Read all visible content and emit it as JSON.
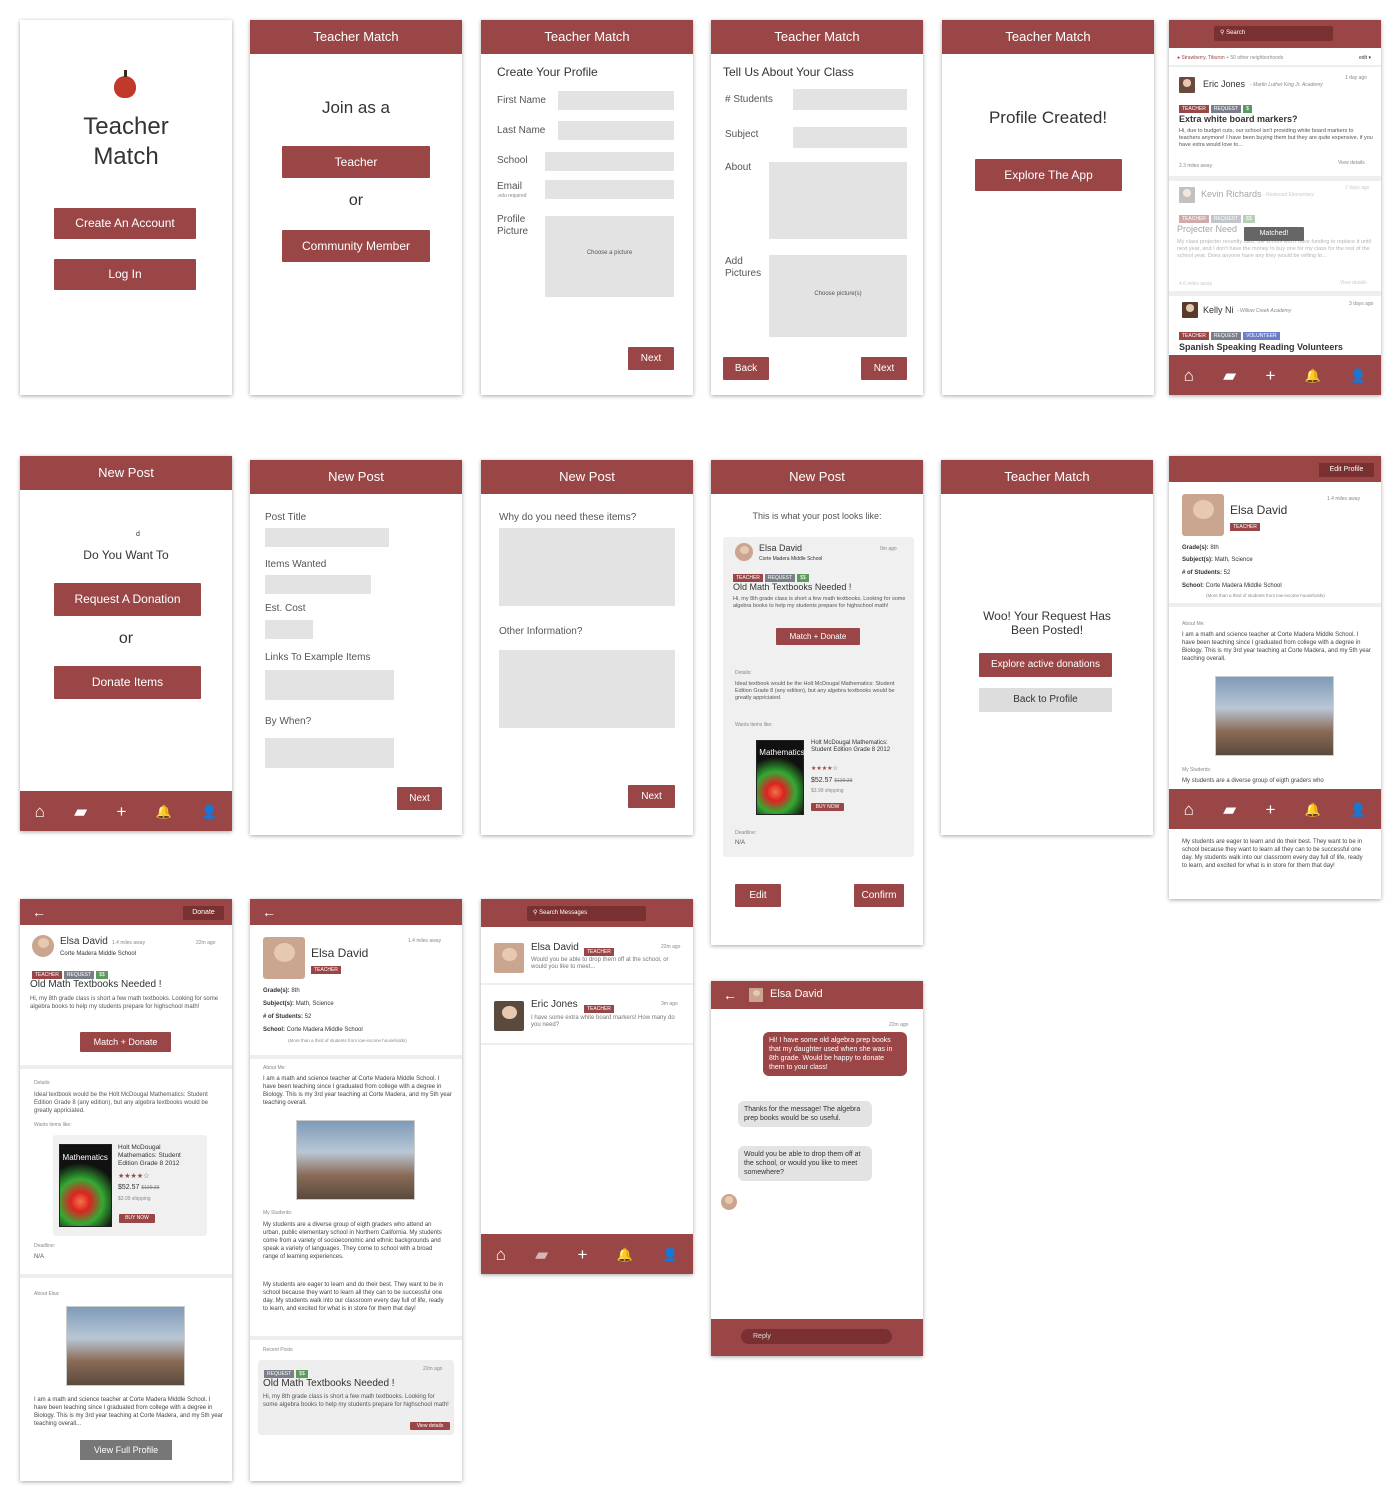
{
  "s1": {
    "title_line1": "Teacher",
    "title_line2": "Match",
    "create": "Create An Account",
    "login": "Log In"
  },
  "s2": {
    "header": "Teacher Match",
    "join": "Join as a",
    "teacher": "Teacher",
    "or": "or",
    "community": "Community Member"
  },
  "s3": {
    "header": "Teacher Match",
    "heading": "Create Your Profile",
    "first": "First Name",
    "last": "Last Name",
    "school": "School",
    "email": "Email",
    "edu": ".edu required",
    "pic1": "Profile",
    "pic2": "Picture",
    "choose": "Choose a picture",
    "next": "Next"
  },
  "s4": {
    "header": "Teacher Match",
    "heading": "Tell Us About Your Class",
    "students": "# Students",
    "subject": "Subject",
    "about": "About",
    "add1": "Add",
    "add2": "Pictures",
    "choose": "Choose picture(s)",
    "back": "Back",
    "next": "Next"
  },
  "s5": {
    "header": "Teacher Match",
    "created": "Profile Created!",
    "explore": "Explore The App"
  },
  "s6": {
    "search": "Search",
    "location": "Strawberry, Tiburon",
    "neighborhoods": "+ 50 other neighborhoods",
    "edit": "edit ▾",
    "post1": {
      "name": "Eric Jones",
      "school": "- Martin Luther King Jr. Academy",
      "time": "1 day ago",
      "title": "Extra white board markers?",
      "body": "Hi, due to budget cuts, our school isn't providing white board markers to teachers anymore! I have been buying them but they are quite expensive, if you have extra would love to...",
      "distance": "2.3 miles away",
      "details": "View details"
    },
    "post2": {
      "name": "Kevin Richards",
      "school": "- Redwood Elementary",
      "time": "2 days ago",
      "title": "Projecter Need",
      "matched": "Matched!",
      "body": "My class projecter recently died, the school won't have funding to replace it until next year, and I don't have the money to buy one for my class for the rest of the school year. Does anyone have any they would be willing to...",
      "distance": "4.6 miles away",
      "details": "View details"
    },
    "post3": {
      "name": "Kelly Ni",
      "school": "- Willow Creek Academy",
      "time": "3 days ago",
      "title": "Spanish Speaking Reading Volunteers"
    }
  },
  "tags": {
    "teacher": "TEACHER",
    "request": "REQUEST",
    "money": "$$",
    "vol": "VOLUNTEER",
    "money1": "$"
  },
  "s7": {
    "header": "New Post",
    "d": "d",
    "want": "Do You Want To",
    "request": "Request A Donation",
    "or": "or",
    "donate": "Donate Items"
  },
  "s8": {
    "header": "New Post",
    "title": "Post Title",
    "items": "Items Wanted",
    "cost": "Est. Cost",
    "links": "Links To Example Items",
    "when": "By When?",
    "next": "Next"
  },
  "s9": {
    "header": "New Post",
    "why": "Why do you need these items?",
    "other": "Other Information?",
    "next": "Next"
  },
  "s10": {
    "header": "New Post",
    "preview": "This is what your post looks like:",
    "name": "Elsa David",
    "school": "Corte Madera Middle School",
    "time": "0m ago",
    "title": "Old Math Textbooks Needed !",
    "body": "Hi, my 8th grade class is short a few math textbooks. Looking for some algebra books to help my students prepare for highschool math!",
    "match": "Match + Donate",
    "details_label": "Details:",
    "details": "Ideal textbook would be the Holt McDougal Mathematics: Student Edition Grade 8 (any edition), but any algebra textbooks would be greatly appriciated.",
    "wants": "Wants items like:",
    "book_title": "Holt McDougal Mathematics: Student Edition Grade 8 2012",
    "stars": "★★★★☆",
    "price": "$52.57",
    "old_price": "$139.33",
    "shipping": "$3.99 shipping",
    "buy": "BUY NOW",
    "deadline_label": "Deadline:",
    "deadline": "N/A",
    "edit": "Edit",
    "confirm": "Confirm",
    "book_cover": "Mathematics"
  },
  "s11": {
    "header": "Teacher Match",
    "posted1": "Woo! Your Request Has",
    "posted2": "Been Posted!",
    "explore": "Explore active donations",
    "back": "Back to Profile"
  },
  "s12": {
    "edit": "Edit Profile",
    "distance": "1.4 miles away",
    "name": "Elsa David",
    "grades_l": "Grade(s):",
    "grades": "8th",
    "subjects_l": "Subject(s):",
    "subjects": "Math, Science",
    "students_l": "# of Students:",
    "students": "52",
    "school_l": "School:",
    "school": "Corte Madera Middle School",
    "note": "(More than a third of students from low-income households)",
    "about_l": "About Me:",
    "about": "I am a math and science teacher at Corte Madera Middle School. I have been teaching since I graduated from college with a degree in Biology. This is my 3rd year teaching at Corte Madera, and my 5th year teaching overall.",
    "mystudents_l": "My Students:",
    "mystudents": "My students are a diverse group of eigth graders who",
    "below": "My students are eager to learn and do their best. They want to be in school because they want to learn all they can to be successful one day. My students walk into our classroom every day full of life, ready to learn, and excited for what is in store for them that day!"
  },
  "s13": {
    "donate": "Donate",
    "name": "Elsa David",
    "distance": "1.4 miles away",
    "time": "22m ago",
    "school": "Corte Madera Middle School",
    "title": "Old Math Textbooks Needed !",
    "body": "Hi, my 8th grade class is short a few math textbooks. Looking for some algebra books to help my students prepare for highschool math!",
    "match": "Match + Donate",
    "details_label": "Details:",
    "details": "Ideal textbook would be the Holt McDougal Mathematics: Student Edition Grade 8 (any edition), but any algebra textbooks would be greatly appriciated.",
    "wants": "Wants items like:",
    "deadline_label": "Deadline:",
    "deadline": "N/A",
    "about_l": "About Elsa:",
    "about": "I am a math and science teacher at Corte Madera Middle School. I have been teaching since I graduated from college with a degree in Biology. This is my 3rd year teaching at Corte Madera, and my 5th year teaching overall...",
    "full": "View Full Profile"
  },
  "s14": {
    "name": "Elsa David",
    "distance": "1.4 miles away",
    "grades_l": "Grade(s):",
    "grades": "8th",
    "subjects_l": "Subject(s):",
    "subjects": "Math, Science",
    "students_l": "# of Students:",
    "students": "52",
    "school_l": "School:",
    "school": "Corte Madera Middle School",
    "note": "(More than a third of students from low-income households)",
    "about_l": "About Me:",
    "about": "I am a math and science teacher at Corte Madera Middle School. I have been teaching since I graduated from college with a degree in Biology. This is my 3rd year teaching at Corte Madera, and my 5th year teaching overall.",
    "mystudents_l": "My Students:",
    "mystudents": "My students are a diverse group of eigth graders who attend an urban, public elementary school in Northern California. My students come from a variety of socioeconomic and ethnic backgrounds and speak a variety of languages. They come to school with a broad range of learning experiences.",
    "mystudents2": "My students are eager to learn and do their best. They want to be in school because they want to learn all they can to be successful one day. My students walk into our classroom every day full of life, ready to learn, and excited for what is in store for them that day!",
    "recent": "Recent Posts",
    "r_time": "22m ago",
    "r_title": "Old Math Textbooks Needed !",
    "r_body": "Hi, my 8th grade class is short a few math textbooks. Looking for some algebra books to help my students prepare for highschool math!",
    "r_details": "View details"
  },
  "s15": {
    "search": "Search Messages",
    "m1": {
      "name": "Elsa David",
      "time": "22m ago",
      "text": "Would you be able to drop them off at the school, or would you like to meet..."
    },
    "m2": {
      "name": "Eric Jones",
      "time": "3m ago",
      "text": "I have some extra white board markers! How many do you need?"
    }
  },
  "s16": {
    "name": "Elsa David",
    "time": "22m ago",
    "msg1": "Hi! I have some old algebra prep books that my daughter used when she was in 8th grade. Would be happy to donate them to your class!",
    "msg2": "Thanks for the message! The algebra prep books would be so useful.",
    "msg3": "Would you be able to drop them off at the school, or would you like to meet somewhere?",
    "reply": "Reply"
  },
  "icons": {
    "home": "⌂",
    "chat": "▰",
    "plus": "+",
    "bell": "🔔",
    "user": "👤",
    "back": "←"
  }
}
